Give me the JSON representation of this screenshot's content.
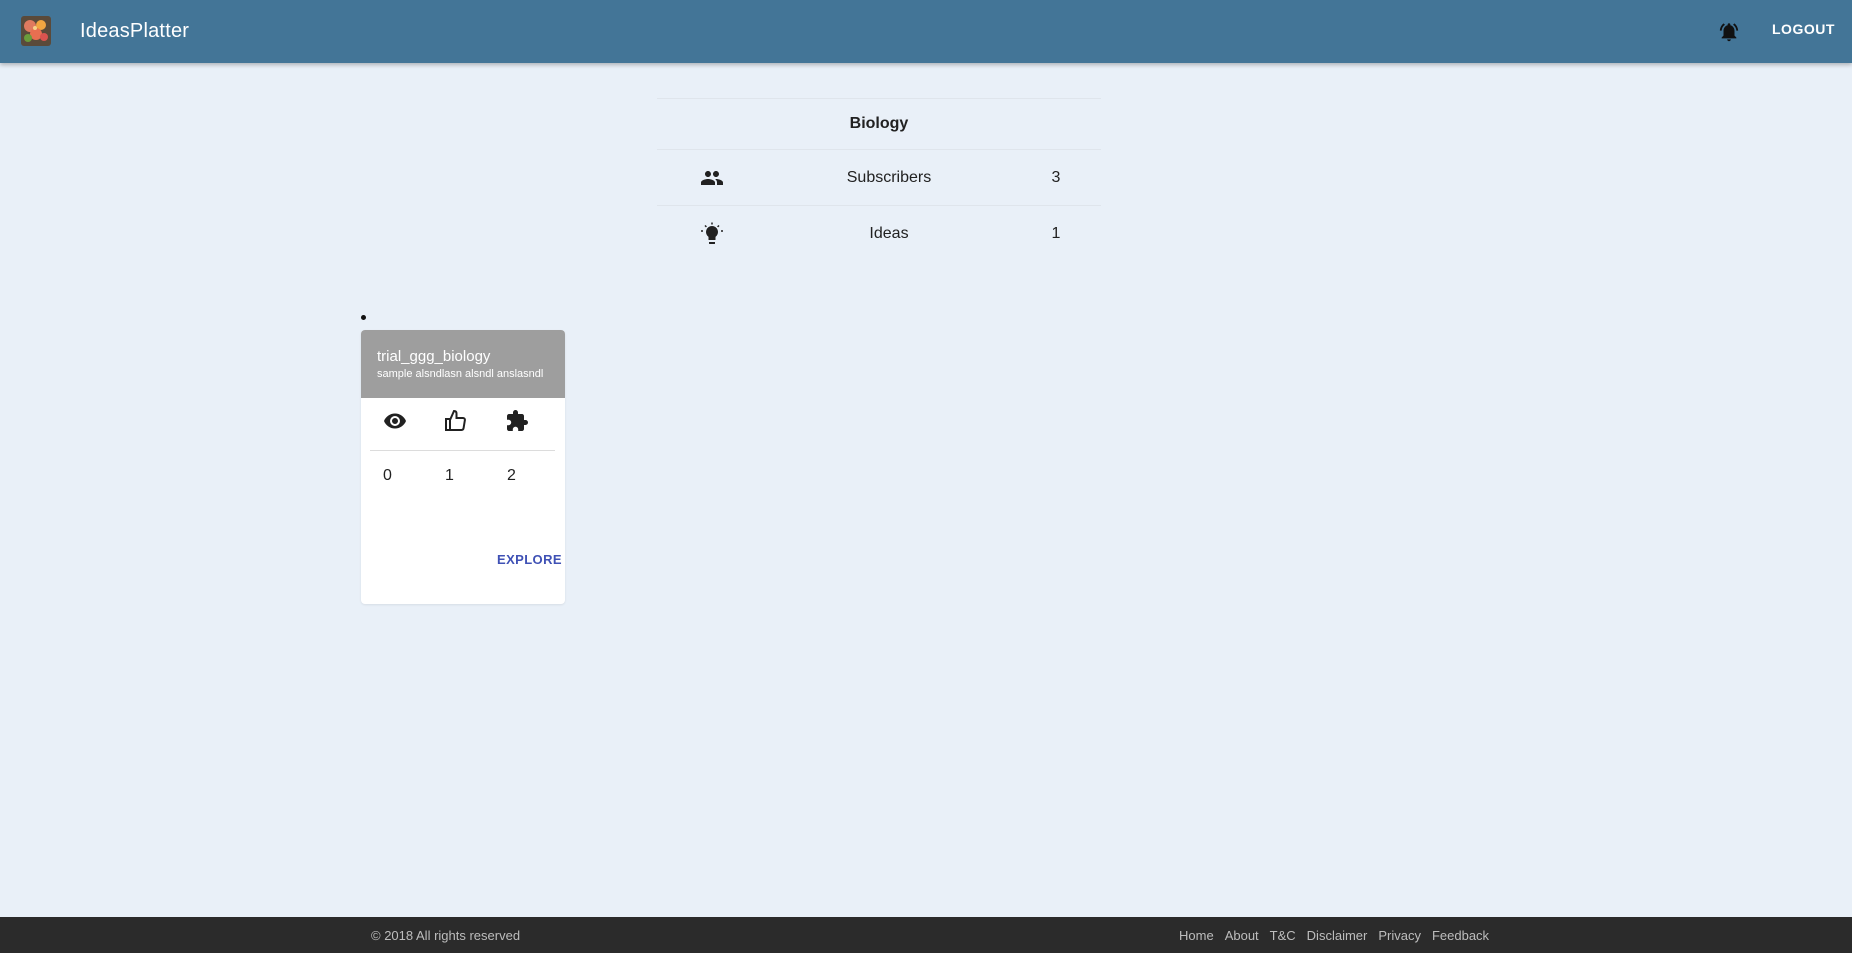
{
  "header": {
    "title": "IdeasPlatter",
    "logout_label": "LOGOUT",
    "logo_icon": "app-logo-icon",
    "notification_icon": "bell-icon",
    "bar_color": "#437597"
  },
  "topic": {
    "name": "Biology",
    "stats": [
      {
        "icon": "people-icon",
        "label": "Subscribers",
        "value": "3"
      },
      {
        "icon": "lightbulb-icon",
        "label": "Ideas",
        "value": "1"
      }
    ]
  },
  "ideas": [
    {
      "title": "trial_ggg_biology",
      "subtitle": "sample alsndlasn alsndl anslasndl",
      "views": "0",
      "likes": "1",
      "contributions": "2",
      "icons": [
        "eye-icon",
        "thumb-up-icon",
        "puzzle-icon"
      ],
      "explore_label": "EXPLORE"
    }
  ],
  "footer": {
    "copyright": "© 2018 All rights reserved",
    "links": [
      "Home",
      "About",
      "T&C",
      "Disclaimer",
      "Privacy",
      "Feedback"
    ]
  }
}
